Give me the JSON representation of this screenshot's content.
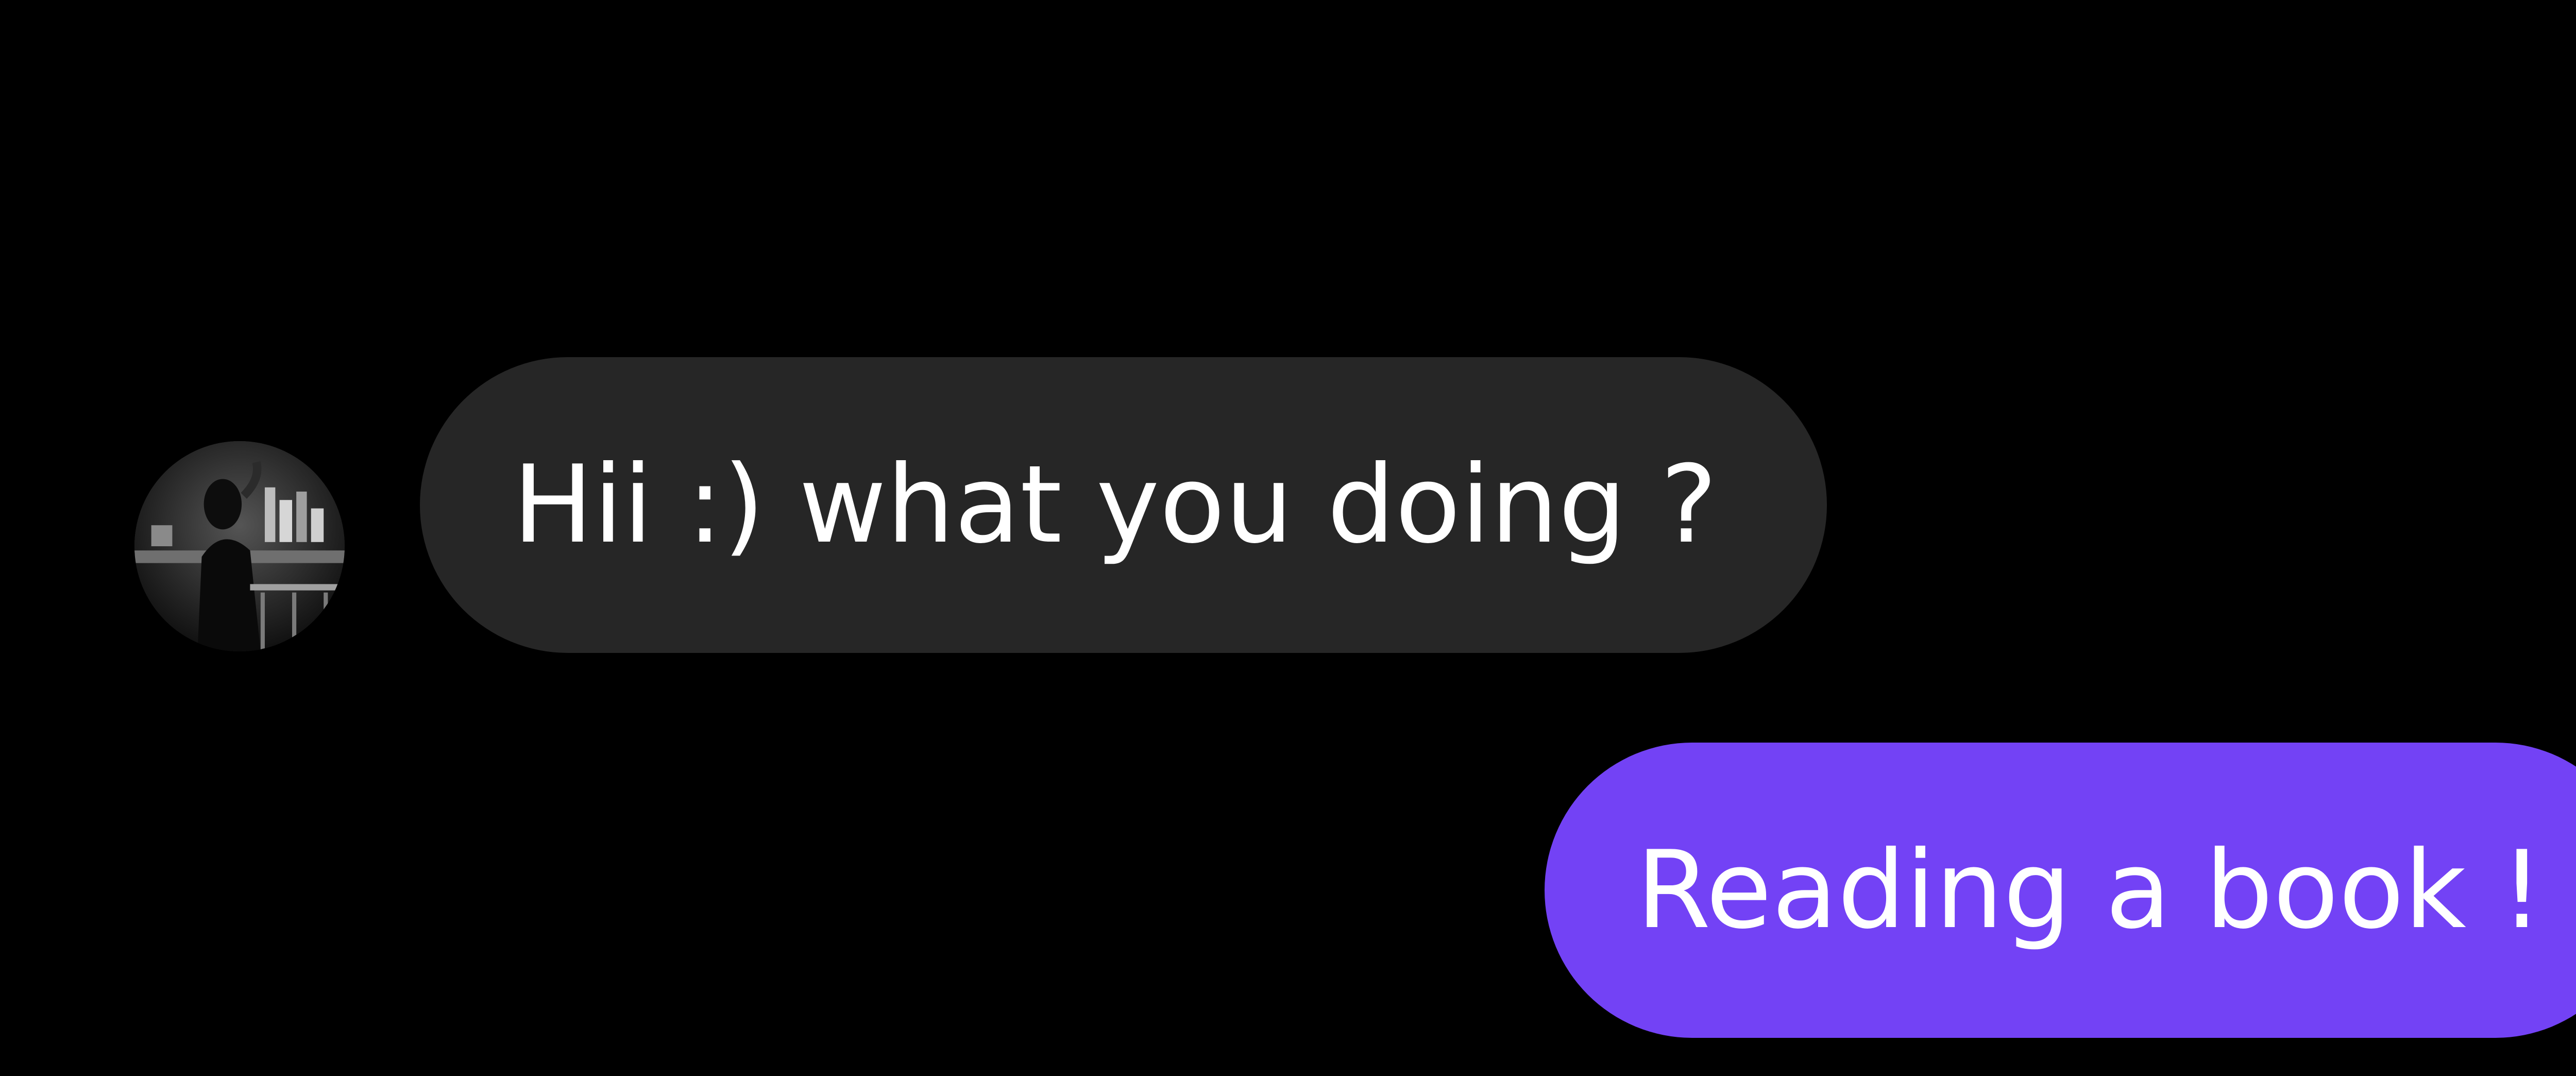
{
  "colors": {
    "background": "#000000",
    "incoming_bubble": "#262626",
    "outgoing_bubble": "#7342f5",
    "text": "#ffffff"
  },
  "messages": [
    {
      "direction": "incoming",
      "text": "Hii :) what you doing ?",
      "has_avatar": true,
      "avatar_icon": "profile-photo"
    },
    {
      "direction": "outgoing",
      "text": "Reading a book !"
    }
  ]
}
